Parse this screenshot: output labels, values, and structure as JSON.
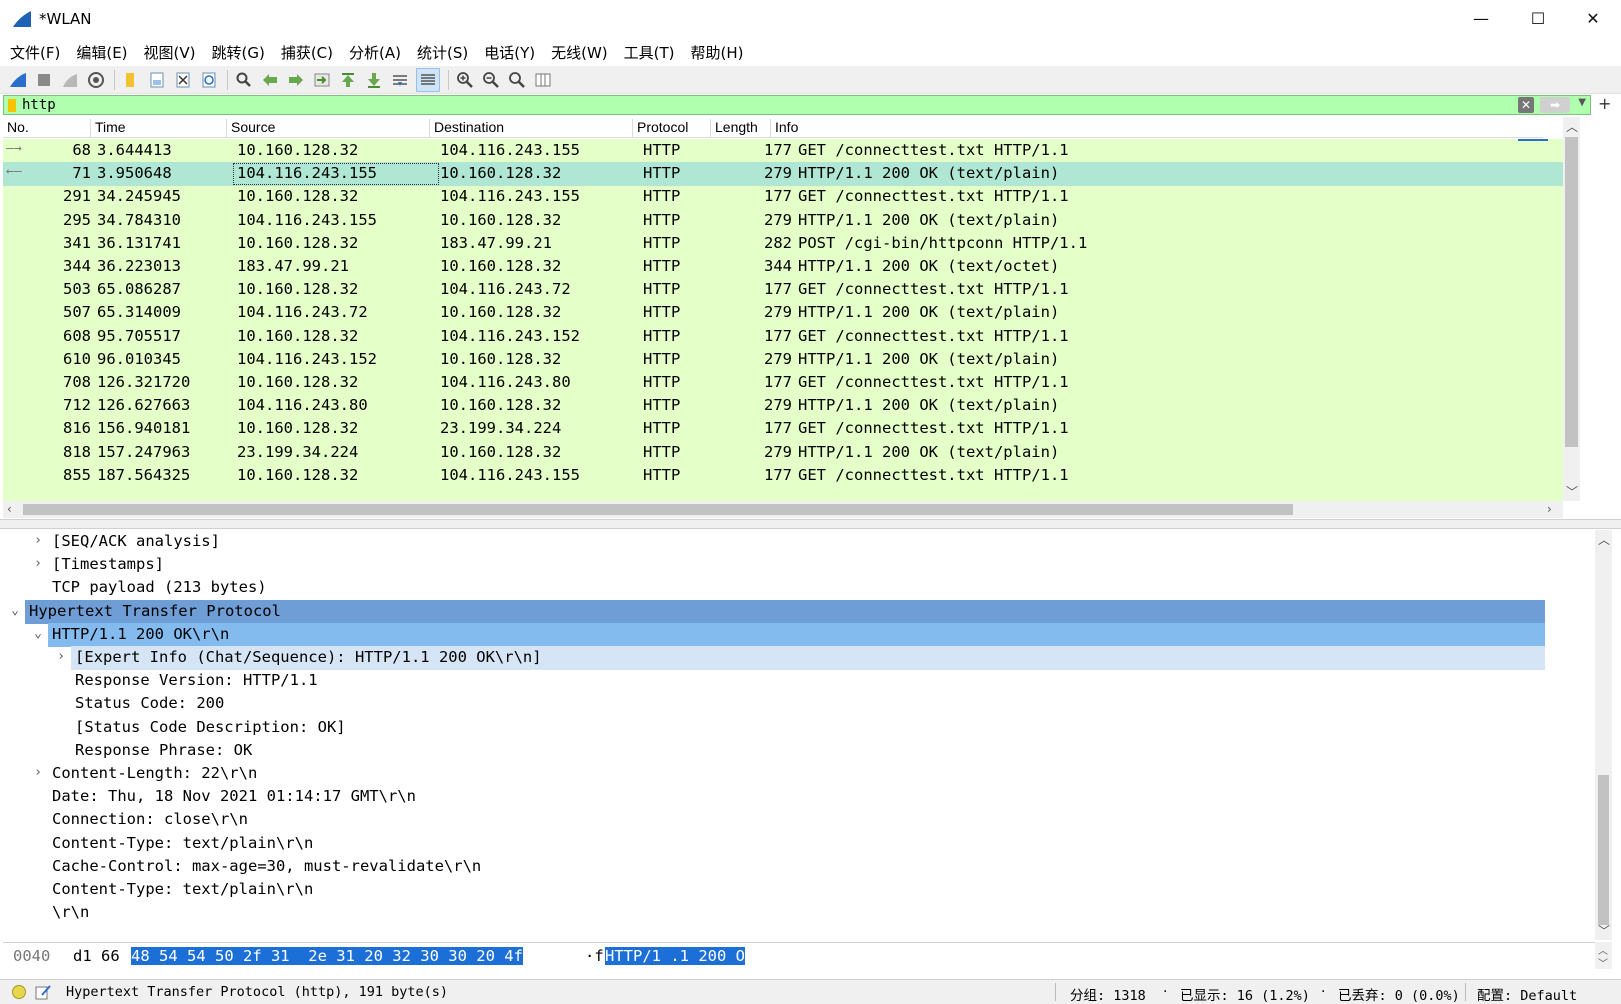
{
  "window": {
    "title": "*WLAN",
    "minimize": "—",
    "maximize": "☐",
    "close": "✕"
  },
  "menu": [
    "文件(F)",
    "编辑(E)",
    "视图(V)",
    "跳转(G)",
    "捕获(C)",
    "分析(A)",
    "统计(S)",
    "电话(Y)",
    "无线(W)",
    "工具(T)",
    "帮助(H)"
  ],
  "filter": {
    "value": "http"
  },
  "columns": [
    "No.",
    "Time",
    "Source",
    "Destination",
    "Protocol",
    "Length",
    "Info"
  ],
  "packets": [
    {
      "no": "68",
      "time": "3.644413",
      "src": "10.160.128.32",
      "dst": "104.116.243.155",
      "proto": "HTTP",
      "len": "177",
      "info": "GET /connecttest.txt HTTP/1.1"
    },
    {
      "no": "71",
      "time": "3.950648",
      "src": "104.116.243.155",
      "dst": "10.160.128.32",
      "proto": "HTTP",
      "len": "279",
      "info": "HTTP/1.1 200 OK  (text/plain)"
    },
    {
      "no": "291",
      "time": "34.245945",
      "src": "10.160.128.32",
      "dst": "104.116.243.155",
      "proto": "HTTP",
      "len": "177",
      "info": "GET /connecttest.txt HTTP/1.1"
    },
    {
      "no": "295",
      "time": "34.784310",
      "src": "104.116.243.155",
      "dst": "10.160.128.32",
      "proto": "HTTP",
      "len": "279",
      "info": "HTTP/1.1 200 OK  (text/plain)"
    },
    {
      "no": "341",
      "time": "36.131741",
      "src": "10.160.128.32",
      "dst": "183.47.99.21",
      "proto": "HTTP",
      "len": "282",
      "info": "POST /cgi-bin/httpconn HTTP/1.1"
    },
    {
      "no": "344",
      "time": "36.223013",
      "src": "183.47.99.21",
      "dst": "10.160.128.32",
      "proto": "HTTP",
      "len": "344",
      "info": "HTTP/1.1 200 OK  (text/octet)"
    },
    {
      "no": "503",
      "time": "65.086287",
      "src": "10.160.128.32",
      "dst": "104.116.243.72",
      "proto": "HTTP",
      "len": "177",
      "info": "GET /connecttest.txt HTTP/1.1"
    },
    {
      "no": "507",
      "time": "65.314009",
      "src": "104.116.243.72",
      "dst": "10.160.128.32",
      "proto": "HTTP",
      "len": "279",
      "info": "HTTP/1.1 200 OK  (text/plain)"
    },
    {
      "no": "608",
      "time": "95.705517",
      "src": "10.160.128.32",
      "dst": "104.116.243.152",
      "proto": "HTTP",
      "len": "177",
      "info": "GET /connecttest.txt HTTP/1.1"
    },
    {
      "no": "610",
      "time": "96.010345",
      "src": "104.116.243.152",
      "dst": "10.160.128.32",
      "proto": "HTTP",
      "len": "279",
      "info": "HTTP/1.1 200 OK  (text/plain)"
    },
    {
      "no": "708",
      "time": "126.321720",
      "src": "10.160.128.32",
      "dst": "104.116.243.80",
      "proto": "HTTP",
      "len": "177",
      "info": "GET /connecttest.txt HTTP/1.1"
    },
    {
      "no": "712",
      "time": "126.627663",
      "src": "104.116.243.80",
      "dst": "10.160.128.32",
      "proto": "HTTP",
      "len": "279",
      "info": "HTTP/1.1 200 OK  (text/plain)"
    },
    {
      "no": "816",
      "time": "156.940181",
      "src": "10.160.128.32",
      "dst": "23.199.34.224",
      "proto": "HTTP",
      "len": "177",
      "info": "GET /connecttest.txt HTTP/1.1"
    },
    {
      "no": "818",
      "time": "157.247963",
      "src": "23.199.34.224",
      "dst": "10.160.128.32",
      "proto": "HTTP",
      "len": "279",
      "info": "HTTP/1.1 200 OK  (text/plain)"
    },
    {
      "no": "855",
      "time": "187.564325",
      "src": "10.160.128.32",
      "dst": "104.116.243.155",
      "proto": "HTTP",
      "len": "177",
      "info": "GET /connecttest.txt HTTP/1.1"
    }
  ],
  "selected_packet": "71",
  "details": [
    {
      "level": 1,
      "expander": "›",
      "text": "[SEQ/ACK analysis]",
      "style": ""
    },
    {
      "level": 1,
      "expander": "›",
      "text": "[Timestamps]",
      "style": ""
    },
    {
      "level": 1,
      "expander": "",
      "text": "TCP payload (213 bytes)",
      "style": ""
    },
    {
      "level": 0,
      "expander": "⌄",
      "text": "Hypertext Transfer Protocol",
      "style": "hl1"
    },
    {
      "level": 1,
      "expander": "⌄",
      "text": "HTTP/1.1 200 OK\\r\\n",
      "style": "hl2"
    },
    {
      "level": 2,
      "expander": "›",
      "text": "[Expert Info (Chat/Sequence): HTTP/1.1 200 OK\\r\\n]",
      "style": "hl3"
    },
    {
      "level": 2,
      "expander": "",
      "text": "Response Version: HTTP/1.1",
      "style": ""
    },
    {
      "level": 2,
      "expander": "",
      "text": "Status Code: 200",
      "style": ""
    },
    {
      "level": 2,
      "expander": "",
      "text": "[Status Code Description: OK]",
      "style": ""
    },
    {
      "level": 2,
      "expander": "",
      "text": "Response Phrase: OK",
      "style": ""
    },
    {
      "level": 1,
      "expander": "›",
      "text": "Content-Length: 22\\r\\n",
      "style": ""
    },
    {
      "level": 1,
      "expander": "",
      "text": "Date: Thu, 18 Nov 2021 01:14:17 GMT\\r\\n",
      "style": ""
    },
    {
      "level": 1,
      "expander": "",
      "text": "Connection: close\\r\\n",
      "style": ""
    },
    {
      "level": 1,
      "expander": "",
      "text": "Content-Type: text/plain\\r\\n",
      "style": ""
    },
    {
      "level": 1,
      "expander": "",
      "text": "Cache-Control: max-age=30, must-revalidate\\r\\n",
      "style": ""
    },
    {
      "level": 1,
      "expander": "",
      "text": "Content-Type: text/plain\\r\\n",
      "style": ""
    },
    {
      "level": 1,
      "expander": "",
      "text": "\\r\\n",
      "style": ""
    }
  ],
  "bytes": {
    "offset": "0040",
    "hex_plain": "d1 66",
    "hex_selected": "48 54 54 50 2f 31  2e 31 20 32 30 30 20 4f",
    "ascii_plain": "·f",
    "ascii_selected": "HTTP/1 .1 200 O"
  },
  "status": {
    "field": "Hypertext Transfer Protocol (http), 191 byte(s)",
    "packets": "分组: 1318",
    "displayed": "已显示: 16 (1.2%)",
    "dropped": "已丢弃: 0 (0.0%)",
    "profile": "配置: Default",
    "dot": "·"
  },
  "colors": {
    "row_bg": "#e4ffc7",
    "row_selected": "#b0e6d4",
    "filter_ok": "#afffaf",
    "detail_hl1": "#6e9ed5",
    "detail_hl2": "#84bbef",
    "bytes_hl": "#1c6fd6"
  },
  "icons": [
    "wireshark-fin-icon",
    "stop-capture-icon",
    "restart-capture-icon",
    "capture-options-icon",
    "open-file-icon",
    "save-file-icon",
    "close-file-icon",
    "reload-icon",
    "find-packet-icon",
    "go-back-icon",
    "go-forward-icon",
    "go-to-packet-icon",
    "go-first-icon",
    "go-last-icon",
    "autoscroll-icon",
    "colorize-icon",
    "zoom-in-icon",
    "zoom-out-icon",
    "zoom-normal-icon",
    "resize-columns-icon"
  ]
}
